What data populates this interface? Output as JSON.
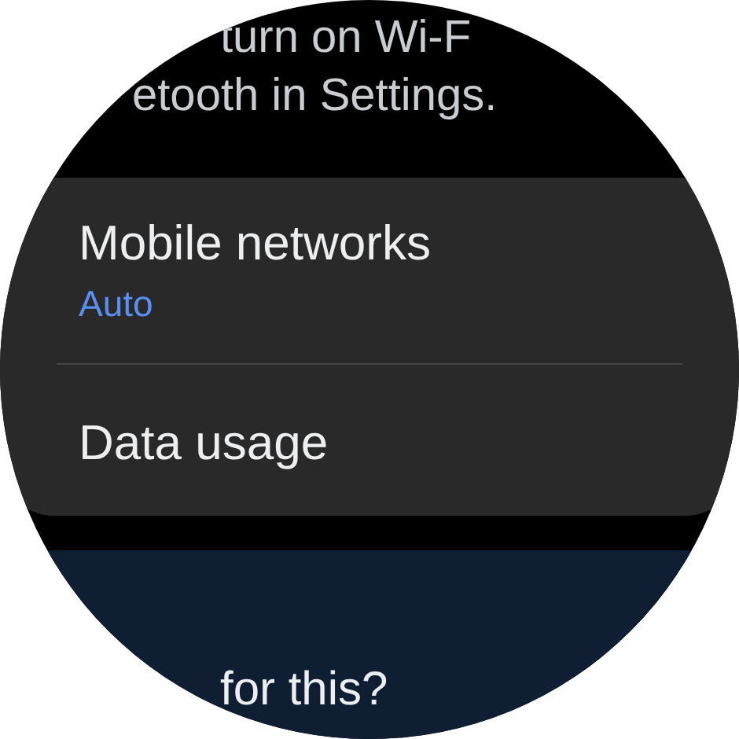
{
  "intro_text": [
    "turn on Wi-F",
    "etooth in Settings."
  ],
  "settings_card": {
    "items": [
      {
        "title": "Mobile networks",
        "subtitle": "Auto"
      },
      {
        "title": "Data usage"
      }
    ]
  },
  "feedback_card": {
    "text": "for this?"
  }
}
